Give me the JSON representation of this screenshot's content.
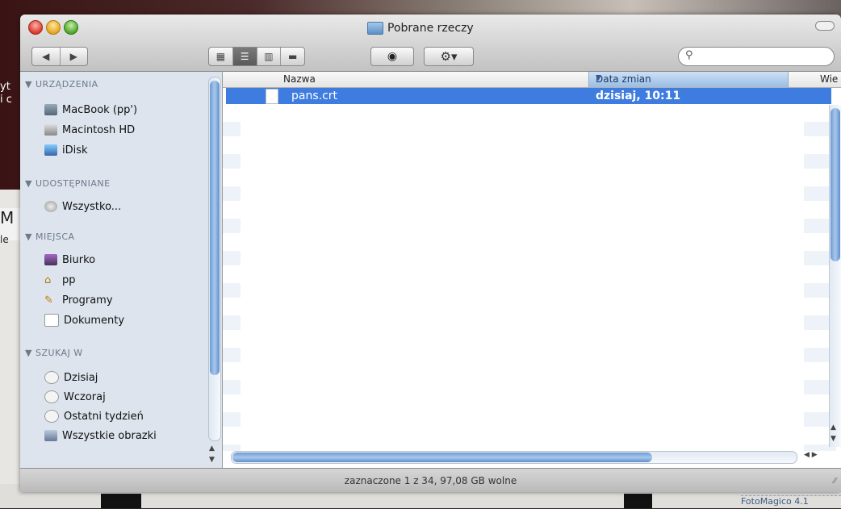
{
  "window": {
    "title": "Pobrane rzeczy"
  },
  "toolbar": {
    "nav_back": "◀",
    "nav_forward": "▶",
    "view_icon": "▦",
    "view_list": "☰",
    "view_columns": "▥",
    "view_coverflow": "▬",
    "eye": "◉",
    "gear": "⚙▾",
    "search_placeholder": ""
  },
  "sidebar": {
    "sections": [
      {
        "label": "▼ URZĄDZENIA"
      },
      {
        "label": "▼ UDOSTĘPNIANE"
      },
      {
        "label": "▼ MIEJSCA"
      },
      {
        "label": "▼ SZUKAJ W"
      }
    ],
    "items": [
      {
        "label": "MacBook (pp')",
        "icon": "laptop-icon"
      },
      {
        "label": "Macintosh HD",
        "icon": "harddisk-icon"
      },
      {
        "label": "iDisk",
        "icon": "idisk-icon"
      },
      {
        "label": "Wszystko...",
        "icon": "network-icon"
      },
      {
        "label": "Biurko",
        "icon": "desktop-icon"
      },
      {
        "label": "pp",
        "icon": "home-icon"
      },
      {
        "label": "Programy",
        "icon": "applications-icon"
      },
      {
        "label": "Dokumenty",
        "icon": "documents-icon"
      },
      {
        "label": "Dzisiaj",
        "icon": "clock-icon"
      },
      {
        "label": "Wczoraj",
        "icon": "clock-icon"
      },
      {
        "label": "Ostatni tydzień",
        "icon": "clock-icon"
      },
      {
        "label": "Wszystkie obrazki",
        "icon": "images-icon"
      }
    ]
  },
  "filelist": {
    "columns": {
      "name": "Nazwa",
      "date": "Data zmian",
      "size": "Wie"
    },
    "rows": [
      {
        "name": "pans.crt",
        "date": "dzisiaj, 10:11",
        "selected": true
      }
    ]
  },
  "statusbar": {
    "text": "zaznaczone 1 z 34, 97,08 GB wolne"
  },
  "background": {
    "left_text": "yt\ni c",
    "left_m": "M",
    "left_le": "le",
    "bottom_right": "FotoMagico 4.1"
  },
  "colors": {
    "selection": "#3f7ce0",
    "sidebar_bg": "#dde4ed"
  }
}
